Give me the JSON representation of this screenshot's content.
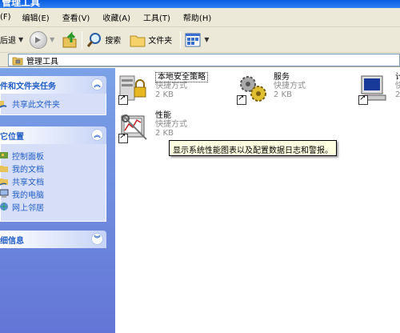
{
  "window": {
    "title": "管理工具"
  },
  "menu": [
    "文件(F)",
    "编辑(E)",
    "查看(V)",
    "收藏(A)",
    "工具(T)",
    "帮助(H)"
  ],
  "menu_visible": [
    "编辑(E)",
    "查看(V)",
    "收藏(A)",
    "工具(T)",
    "帮助(H)"
  ],
  "menu_cut": "(F)",
  "toolbar": {
    "back_label": "后退",
    "search_label": "搜索",
    "folders_label": "文件夹"
  },
  "address": {
    "path": "管理工具"
  },
  "taskpane": {
    "file_tasks": {
      "title": "件和文件夹任务",
      "items": [
        "共享此文件夹"
      ]
    },
    "other_places": {
      "title": "它位置",
      "items": [
        "控制面板",
        "我的文档",
        "共享文档",
        "我的电脑",
        "网上邻居"
      ]
    },
    "details": {
      "title": "细信息"
    }
  },
  "files": [
    {
      "name": "本地安全策略",
      "type": "快捷方式",
      "size": "2 KB"
    },
    {
      "name": "服务",
      "type": "快捷方式",
      "size": "2 KB"
    },
    {
      "name": "计",
      "type": "快",
      "size": "2"
    },
    {
      "name": "性能",
      "type": "快捷方式",
      "size": "2 KB"
    }
  ],
  "tooltip": "显示系统性能图表以及配置数据日志和警报。",
  "colors": {
    "taskpane_bg": "#7ba2e7",
    "link": "#215dc6",
    "toolbar_bg": "#ece9d8",
    "tooltip_bg": "#ffffe1"
  }
}
